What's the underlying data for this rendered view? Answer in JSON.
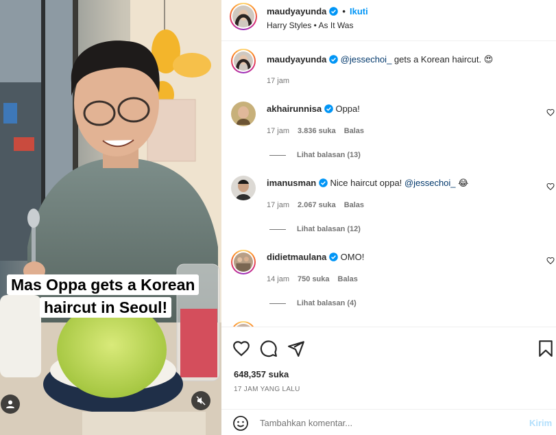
{
  "media": {
    "caption_line1": "Mas Oppa gets a Korean",
    "caption_line2": "haircut in Seoul!"
  },
  "header": {
    "username": "maudyayunda",
    "separator": "•",
    "follow_label": "Ikuti",
    "audio": "Harry Styles • As It Was"
  },
  "caption": {
    "username": "maudyayunda",
    "mention": "@jessechoi_",
    "text": " gets a Korean haircut. 😍",
    "time": "17 jam"
  },
  "comments": [
    {
      "username": "akhairunnisa",
      "text": "Oppa!",
      "time": "17 jam",
      "likes": "3.836 suka",
      "reply_label": "Balas",
      "view_replies": "Lihat balasan (13)"
    },
    {
      "username": "imanusman",
      "text": "Nice haircut oppa! ",
      "mention": "@jessechoi_",
      "emoji": " 😂",
      "time": "17 jam",
      "likes": "2.067 suka",
      "reply_label": "Balas",
      "view_replies": "Lihat balasan (12)"
    },
    {
      "username": "didietmaulana",
      "text": "OMO!",
      "time": "14 jam",
      "likes": "750 suka",
      "reply_label": "Balas",
      "view_replies": "Lihat balasan (4)"
    }
  ],
  "actions": {
    "likes": "648,357 suka",
    "post_time": "17 JAM YANG LALU"
  },
  "add_comment": {
    "placeholder": "Tambahkan komentar...",
    "send_label": "Kirim"
  },
  "colors": {
    "link_blue": "#0095f6",
    "mention_blue": "#00376b",
    "verified_blue": "#0095f6",
    "send_disabled": "#b2dffc",
    "secondary_text": "#737373"
  },
  "icons": [
    "verified-badge-icon",
    "heart-icon",
    "comment-icon",
    "share-icon",
    "bookmark-icon",
    "emoji-icon",
    "user-tag-icon",
    "muted-speaker-icon"
  ]
}
